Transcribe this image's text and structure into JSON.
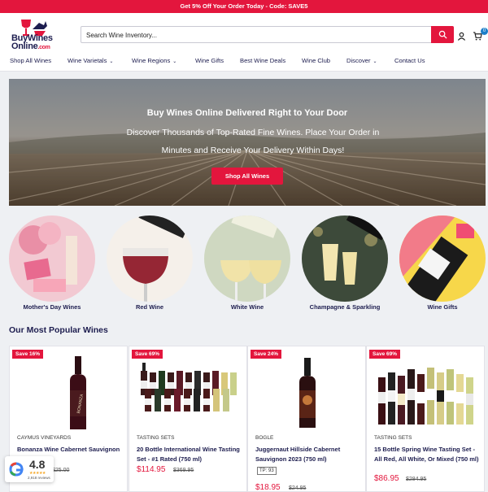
{
  "promo": {
    "text": "Get 5% Off Your Order Today - Code: SAVE5"
  },
  "logo": {
    "line1": "BuyWines",
    "line2": "Online",
    "suffix": ".com"
  },
  "search": {
    "placeholder": "Search Wine Inventory..."
  },
  "cart": {
    "count": "0"
  },
  "nav": [
    {
      "label": "Shop All Wines",
      "dropdown": false
    },
    {
      "label": "Wine Varietals",
      "dropdown": true
    },
    {
      "label": "Wine Regions",
      "dropdown": true
    },
    {
      "label": "Wine Gifts",
      "dropdown": false
    },
    {
      "label": "Best Wine Deals",
      "dropdown": false
    },
    {
      "label": "Wine Club",
      "dropdown": false
    },
    {
      "label": "Discover",
      "dropdown": true
    },
    {
      "label": "Contact Us",
      "dropdown": false
    }
  ],
  "hero": {
    "title": "Buy Wines Online Delivered Right to Your Door",
    "subtitle": "Discover Thousands of Top-Rated Fine Wines. Place Your Order in Minutes and Receive Your Delivery Within Days!",
    "button": "Shop All Wines"
  },
  "categories": [
    {
      "label": "Mother's Day Wines"
    },
    {
      "label": "Red Wine"
    },
    {
      "label": "White Wine"
    },
    {
      "label": "Champagne & Sparkling"
    },
    {
      "label": "Wine Gifts"
    }
  ],
  "section_title": "Our Most Popular Wines",
  "products": [
    {
      "badge": "Save 16%",
      "vendor": "CAYMUS VINEYARDS",
      "name": "Bonanza Wine Cabernet Sauvignon (750 ml)",
      "price": "",
      "old_price": "$25.00"
    },
    {
      "badge": "Save 69%",
      "vendor": "TASTING SETS",
      "name": "20 Bottle International Wine Tasting Set - #1 Rated (750 ml)",
      "price": "$114.95",
      "old_price": "$369.95"
    },
    {
      "badge": "Save 24%",
      "vendor": "BOGLE",
      "name": "Juggernaut Hillside Cabernet Sauvignon 2023 (750 ml)",
      "tp": "TP: 93",
      "price": "$18.95",
      "old_price": "$24.95"
    },
    {
      "badge": "Save 69%",
      "vendor": "TASTING SETS",
      "name": "15 Bottle Spring Wine Tasting Set - All Red, All White, Or Mixed (750 ml)",
      "price": "$86.95",
      "old_price": "$284.95"
    }
  ],
  "reviews": {
    "score": "4.8",
    "stars": "★★★★★",
    "count": "2,918 reviews"
  },
  "colors": {
    "brand_red": "#e3163d",
    "navy": "#1d1d4f",
    "badge_blue": "#1d7fc9"
  }
}
